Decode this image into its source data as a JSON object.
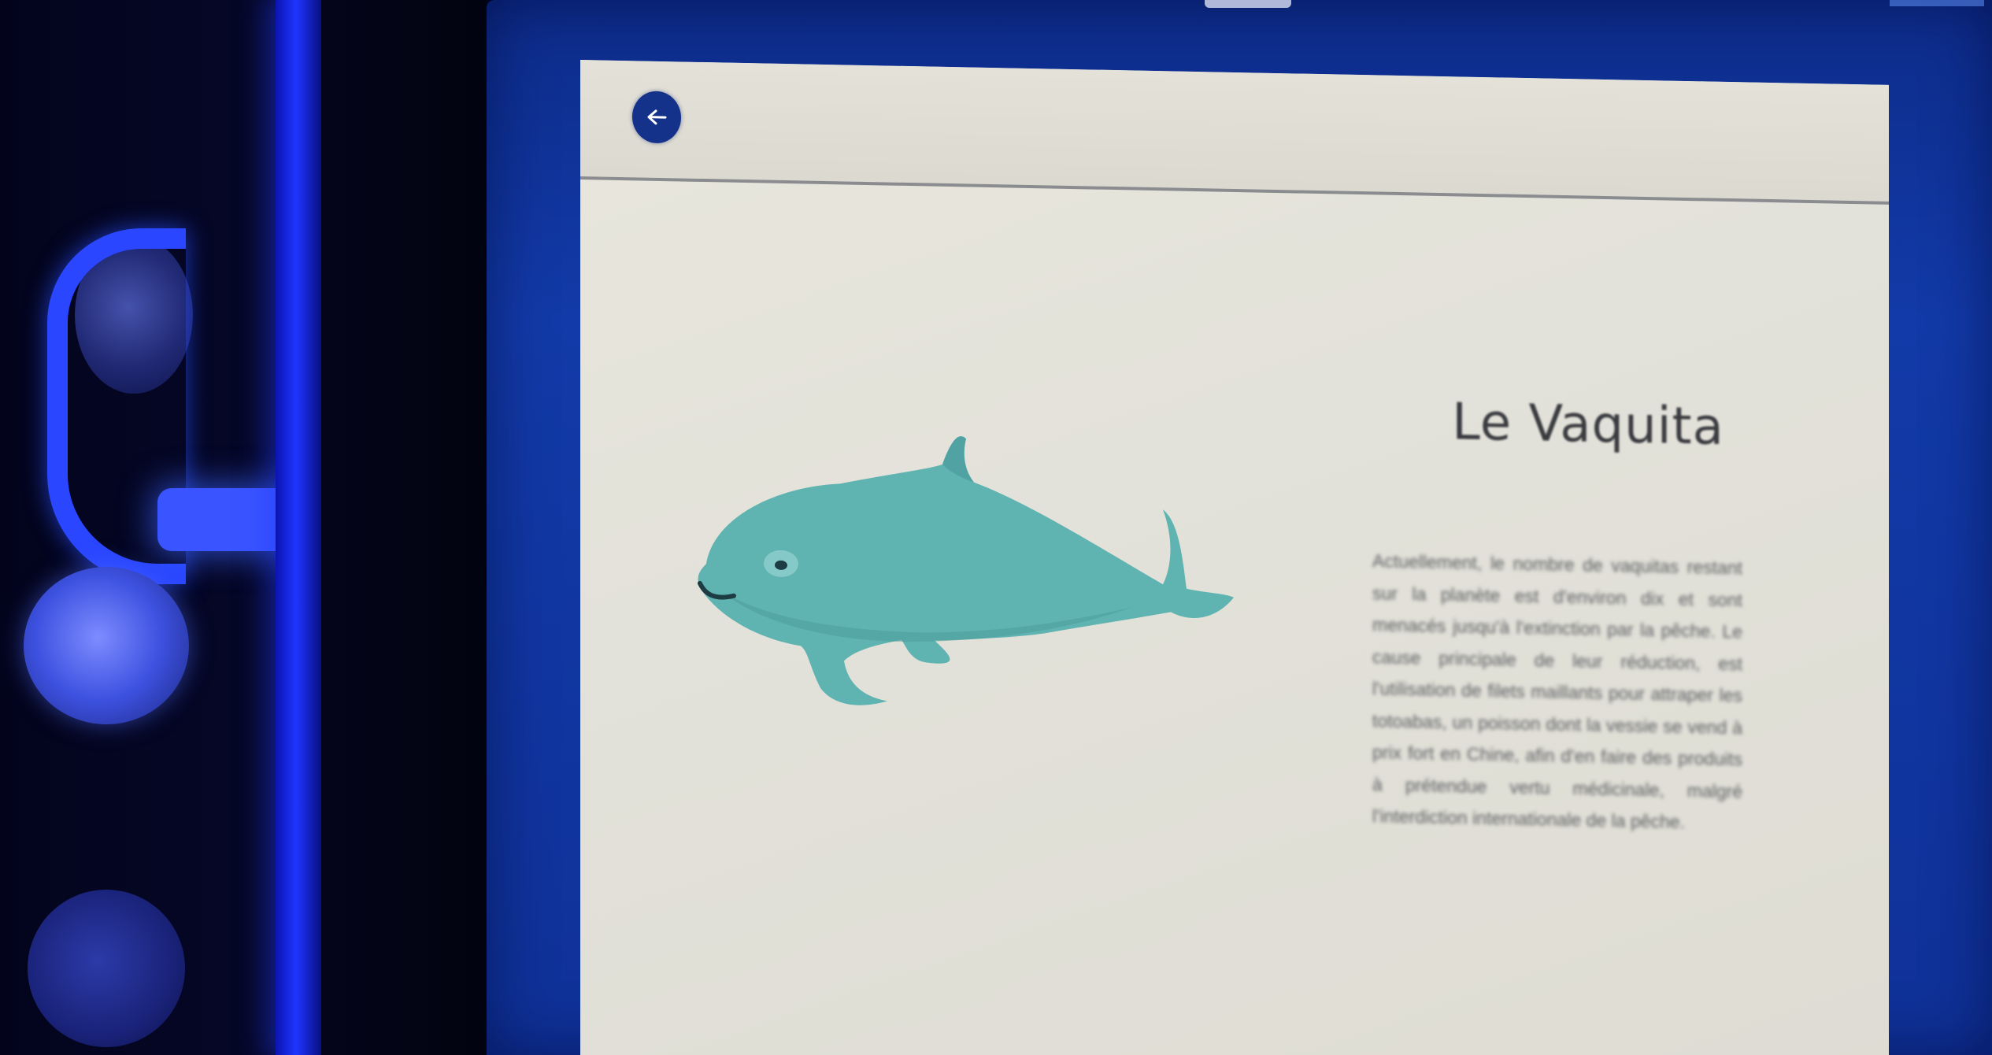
{
  "app": {
    "back_icon": "back-arrow-icon"
  },
  "article": {
    "title": "Le Vaquita",
    "body": "Actuellement, le nombre de vaquitas restant sur la planète est d'environ dix et sont menacés jusqu'à l'extinction par la pêche. Le cause principale de leur réduction, est l'utilisation de filets maillants pour attraper les totoabas, un poisson dont la vessie se vend à prix fort en Chine, afin d'en faire des produits à prétendue vertu médicinale, malgré l'interdiction internationale de la pêche.",
    "illustration": "vaquita-porpoise-illustration"
  },
  "colors": {
    "frame_blue": "#123aa8",
    "neon_blue": "#1f35ff",
    "screen_bg": "#e3e2da",
    "vaquita_teal": "#5fb3b1",
    "button_blue": "#15328a"
  }
}
